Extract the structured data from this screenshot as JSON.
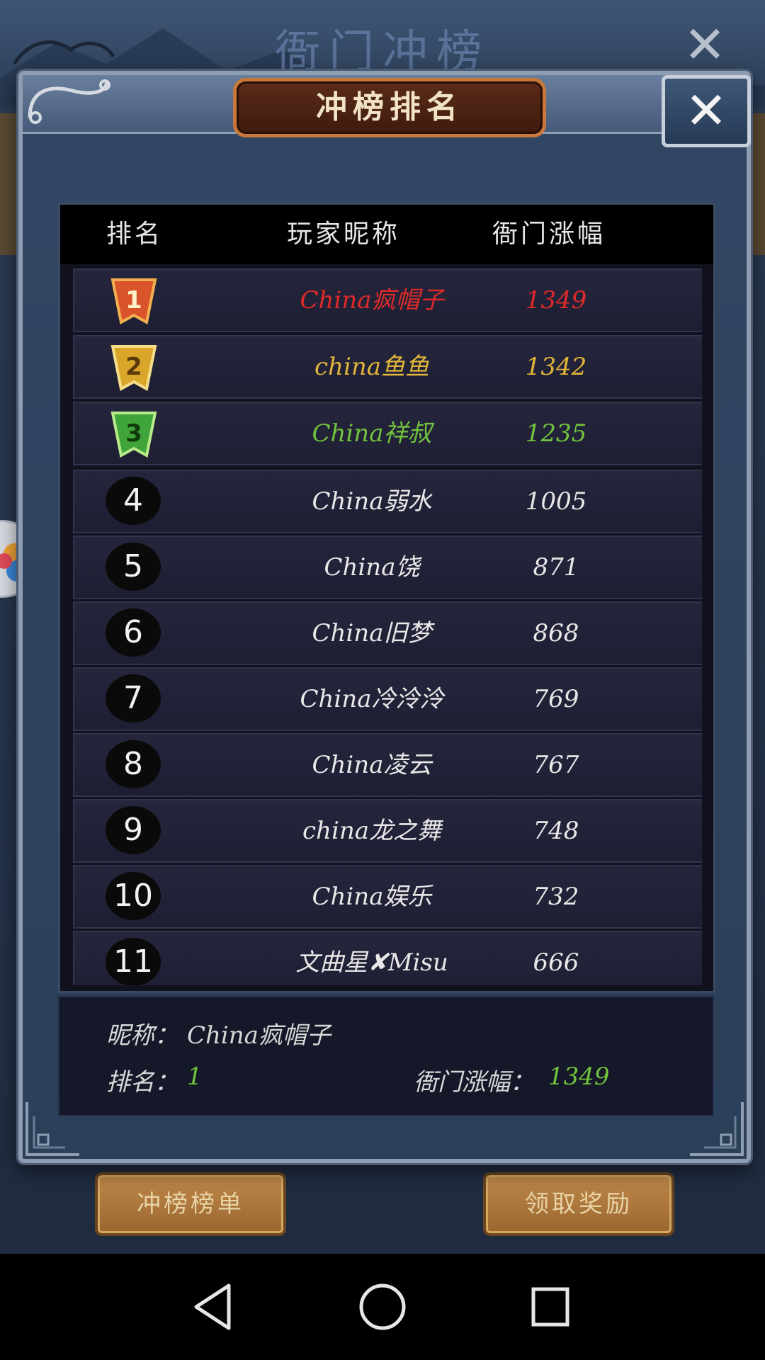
{
  "background": {
    "title": "衙门冲榜",
    "close_glyph": "✕",
    "buttons": {
      "left_label": "冲榜榜单",
      "right_label": "领取奖励"
    }
  },
  "modal": {
    "title": "冲榜排名",
    "close_glyph": "✕",
    "columns": {
      "rank": "排名",
      "name": "玩家昵称",
      "gain": "衙门涨幅"
    },
    "rows": [
      {
        "rank": "1",
        "name": "China疯帽子",
        "gain": "1349",
        "color": "#e02a2a"
      },
      {
        "rank": "2",
        "name": "china鱼鱼",
        "gain": "1342",
        "color": "#e2b53a"
      },
      {
        "rank": "3",
        "name": "China祥叔",
        "gain": "1235",
        "color": "#71c33e"
      },
      {
        "rank": "4",
        "name": "China弱水",
        "gain": "1005",
        "color": "#e8e8e8"
      },
      {
        "rank": "5",
        "name": "China饶",
        "gain": "871",
        "color": "#e8e8e8"
      },
      {
        "rank": "6",
        "name": "China旧梦",
        "gain": "868",
        "color": "#e8e8e8"
      },
      {
        "rank": "7",
        "name": "China冷泠泠",
        "gain": "769",
        "color": "#e8e8e8"
      },
      {
        "rank": "8",
        "name": "China凌云",
        "gain": "767",
        "color": "#e8e8e8"
      },
      {
        "rank": "9",
        "name": "china龙之舞",
        "gain": "748",
        "color": "#e8e8e8"
      },
      {
        "rank": "10",
        "name": "China娱乐",
        "gain": "732",
        "color": "#e8e8e8"
      },
      {
        "rank": "11",
        "name": "文曲星✘Misu",
        "gain": "666",
        "color": "#e8e8e8"
      }
    ],
    "self": {
      "nickname_label": "昵称：",
      "nickname": "China疯帽子",
      "rank_label": "排名：",
      "rank": "1",
      "gain_label": "衙门涨幅：",
      "gain": "1349"
    }
  },
  "colors": {
    "highlight_value": "#71c33e"
  },
  "icons": {
    "nav": [
      "back-icon",
      "home-icon",
      "recent-apps-icon"
    ]
  }
}
